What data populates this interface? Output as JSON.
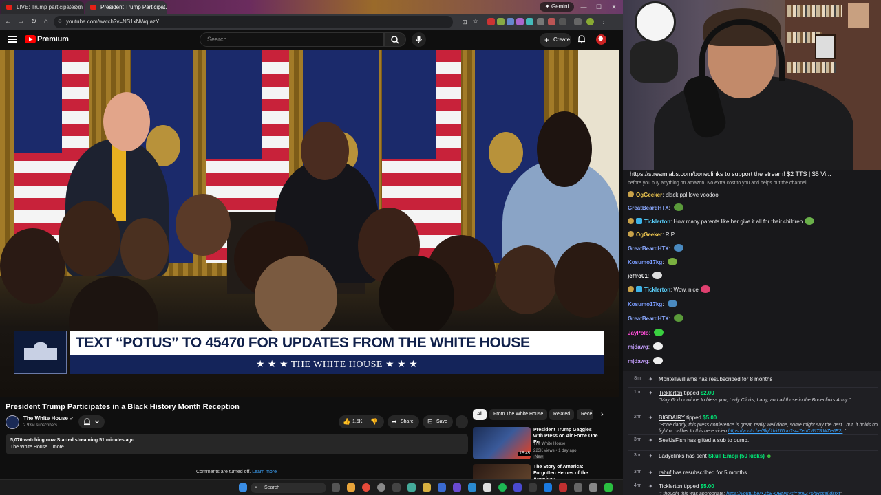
{
  "browser": {
    "tabs": [
      "LIVE: Trump participates in Bla...",
      "President Trump Participat..."
    ],
    "gemini_label": "Gemini",
    "url": "youtube.com/watch?v=NS1xNWqIazY"
  },
  "youtube": {
    "brand": "Premium",
    "search_placeholder": "Search",
    "create_label": "Create",
    "video": {
      "banner_text": "TEXT “POTUS” TO 45470 FOR UPDATES FROM THE WHITE HOUSE",
      "banner_sub": "★ ★ ★   THE WHITE HOUSE   ★ ★ ★",
      "title": "President Trump Participates in a Black History Month Reception",
      "channel": "The White House",
      "subscribers": "2.93M subscribers",
      "likes": "1.5K",
      "share_label": "Share",
      "save_label": "Save",
      "desc_line1": "5,070 watching now  Started streaming 51 minutes ago",
      "desc_line2": "The White House ...more",
      "comments_off": "Comments are turned off.",
      "learn_more": "Learn more"
    },
    "chips": [
      "All",
      "From The White House",
      "Related",
      "Rece"
    ],
    "recommendations": [
      {
        "title": "President Trump Gaggles with Press on Air Force One En ...",
        "channel": "The White House",
        "meta": "223K views • 1 day ago",
        "badge": "New",
        "duration": "15:45"
      },
      {
        "title": "The Story of America: Forgotten Heroes of the American ...",
        "channel": "",
        "meta": "",
        "badge": "",
        "duration": ""
      }
    ]
  },
  "taskbar": {
    "search_label": "Search"
  },
  "chat": {
    "banner_link": "https://streamlabs.com/boneclinks",
    "banner_text": " to support the stream! $2 TTS | $5 Vi...",
    "sub_text": "before you buy anything on amazon. No extra cost to you and helps out the channel.",
    "messages": [
      {
        "user": "OgGeeker",
        "text": "black ppl love voodoo",
        "color": "#f0c850",
        "badge": "b1"
      },
      {
        "user": "GreatBeardHTX",
        "text": "",
        "color": "#8aa8ff",
        "badge": "",
        "emote": "#5a9a3a"
      },
      {
        "user": "Ticklerton",
        "text": "How many parents like her give it all for their children",
        "color": "#5bd3ff",
        "badge": "b1b2",
        "emote": "#6ab04a"
      },
      {
        "user": "OgGeeker",
        "text": "RIP",
        "color": "#f0c850",
        "badge": "b1"
      },
      {
        "user": "GreatBeardHTX",
        "text": "",
        "color": "#8aa8ff",
        "badge": "",
        "emote": "#4a8ac0"
      },
      {
        "user": "Kosumo17kg",
        "text": "",
        "color": "#7a9cff",
        "badge": "",
        "emote": "#7ab040"
      },
      {
        "user": "jeffro01",
        "text": "",
        "color": "#ffffff",
        "badge": "",
        "emote": "#dddddd"
      },
      {
        "user": "Ticklerton",
        "text": "Wow, nice",
        "color": "#5bd3ff",
        "badge": "b1b2",
        "emote": "#e04070"
      },
      {
        "user": "Kosumo17kg",
        "text": "",
        "color": "#7a9cff",
        "badge": "",
        "emote": "#4a8ac0"
      },
      {
        "user": "GreatBeardHTX",
        "text": "",
        "color": "#8aa8ff",
        "badge": "",
        "emote": "#5a9a3a"
      },
      {
        "user": "JayPolo",
        "text": "",
        "color": "#ff4fd8",
        "badge": "",
        "emote": "#3ad040"
      },
      {
        "user": "mjdawg",
        "text": "",
        "color": "#c59fff",
        "badge": "",
        "emote": "#eeeeee"
      },
      {
        "user": "mjdawg",
        "text": "",
        "color": "#c59fff",
        "badge": "",
        "emote": "#eeeeee"
      }
    ]
  },
  "events": [
    {
      "time": "8m",
      "user": "MontellWilliams",
      "action": " has resubscribed for 8 months",
      "amount": "",
      "quote": ""
    },
    {
      "time": "1hr",
      "user": "Ticklerton",
      "action": " tipped ",
      "amount": "$2.00",
      "quote": "\"May God continue to bless you, Lady Clinks, Larry, and all those in the Boneclinks Army.\""
    },
    {
      "time": "2hr",
      "user": "BIGDAIRY",
      "action": " tipped ",
      "amount": "$5.00",
      "quote": "\"Bone daddy, this press conference is great, really well done, some might say the best.. but, it holds no light or caliber to this here video ",
      "link": "https://youtu.be/3lqf1hkIWUo?si=7ebCWITRWZe6E2t",
      "quote_end": ".\""
    },
    {
      "time": "3hr",
      "user": "SeaUsFish",
      "action": " has gifted a sub to oumb.",
      "amount": "",
      "quote": ""
    },
    {
      "time": "3hr",
      "user": "Ladyclinks",
      "action": " has sent ",
      "amount": "Skull Emoji (50 kicks)",
      "quote": ""
    },
    {
      "time": "3hr",
      "user": "rabuf",
      "action": " has resubscribed for 5 months",
      "amount": "",
      "quote": ""
    },
    {
      "time": "4hr",
      "user": "Ticklerton",
      "action": " tipped ",
      "amount": "$5.00",
      "quote": "\"I thought this was appropriate: ",
      "link": "https://youtu.be/XZbE-QBtwk?si=4mlZ76hRssel.dsrxt",
      "quote_end": "\""
    }
  ]
}
